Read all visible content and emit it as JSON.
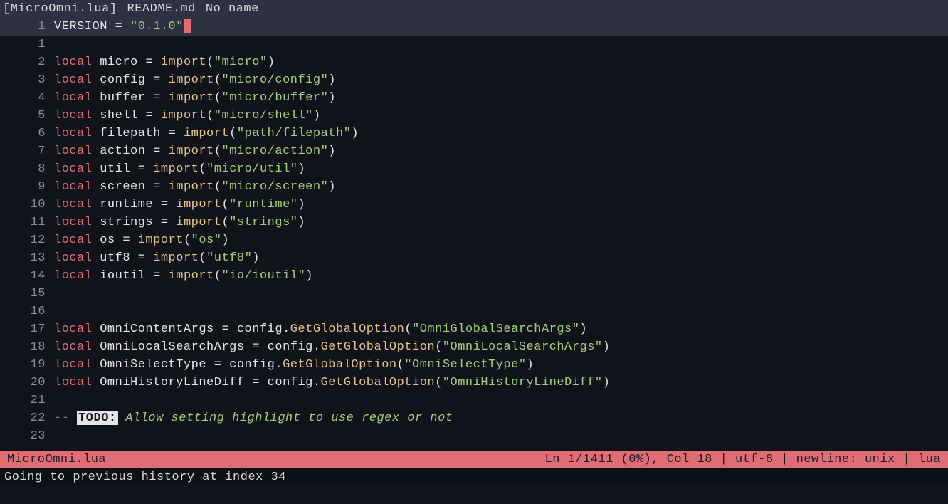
{
  "tabs": [
    {
      "label": "[MicroOmni.lua]",
      "active": true
    },
    {
      "label": "README.md",
      "active": false
    },
    {
      "label": "No name",
      "active": false
    }
  ],
  "code": {
    "lines": [
      {
        "n": 1,
        "current": true,
        "cursor": true,
        "tokens": [
          [
            "ident",
            "VERSION"
          ],
          [
            "op",
            " = "
          ],
          [
            "str",
            "\"0.1.0\""
          ]
        ]
      },
      {
        "n": 1,
        "tokens": []
      },
      {
        "n": 2,
        "tokens": [
          [
            "kw",
            "local"
          ],
          [
            "ident",
            " micro "
          ],
          [
            "op",
            "= "
          ],
          [
            "func",
            "import"
          ],
          [
            "punc",
            "("
          ],
          [
            "str",
            "\"micro\""
          ],
          [
            "punc",
            ")"
          ]
        ]
      },
      {
        "n": 3,
        "tokens": [
          [
            "kw",
            "local"
          ],
          [
            "ident",
            " config "
          ],
          [
            "op",
            "= "
          ],
          [
            "func",
            "import"
          ],
          [
            "punc",
            "("
          ],
          [
            "str",
            "\"micro/config\""
          ],
          [
            "punc",
            ")"
          ]
        ]
      },
      {
        "n": 4,
        "tokens": [
          [
            "kw",
            "local"
          ],
          [
            "ident",
            " buffer "
          ],
          [
            "op",
            "= "
          ],
          [
            "func",
            "import"
          ],
          [
            "punc",
            "("
          ],
          [
            "str",
            "\"micro/buffer\""
          ],
          [
            "punc",
            ")"
          ]
        ]
      },
      {
        "n": 5,
        "tokens": [
          [
            "kw",
            "local"
          ],
          [
            "ident",
            " shell "
          ],
          [
            "op",
            "= "
          ],
          [
            "func",
            "import"
          ],
          [
            "punc",
            "("
          ],
          [
            "str",
            "\"micro/shell\""
          ],
          [
            "punc",
            ")"
          ]
        ]
      },
      {
        "n": 6,
        "tokens": [
          [
            "kw",
            "local"
          ],
          [
            "ident",
            " filepath "
          ],
          [
            "op",
            "= "
          ],
          [
            "func",
            "import"
          ],
          [
            "punc",
            "("
          ],
          [
            "str",
            "\"path/filepath\""
          ],
          [
            "punc",
            ")"
          ]
        ]
      },
      {
        "n": 7,
        "tokens": [
          [
            "kw",
            "local"
          ],
          [
            "ident",
            " action "
          ],
          [
            "op",
            "= "
          ],
          [
            "func",
            "import"
          ],
          [
            "punc",
            "("
          ],
          [
            "str",
            "\"micro/action\""
          ],
          [
            "punc",
            ")"
          ]
        ]
      },
      {
        "n": 8,
        "tokens": [
          [
            "kw",
            "local"
          ],
          [
            "ident",
            " util "
          ],
          [
            "op",
            "= "
          ],
          [
            "func",
            "import"
          ],
          [
            "punc",
            "("
          ],
          [
            "str",
            "\"micro/util\""
          ],
          [
            "punc",
            ")"
          ]
        ]
      },
      {
        "n": 9,
        "tokens": [
          [
            "kw",
            "local"
          ],
          [
            "ident",
            " screen "
          ],
          [
            "op",
            "= "
          ],
          [
            "func",
            "import"
          ],
          [
            "punc",
            "("
          ],
          [
            "str",
            "\"micro/screen\""
          ],
          [
            "punc",
            ")"
          ]
        ]
      },
      {
        "n": 10,
        "tokens": [
          [
            "kw",
            "local"
          ],
          [
            "ident",
            " runtime "
          ],
          [
            "op",
            "= "
          ],
          [
            "func",
            "import"
          ],
          [
            "punc",
            "("
          ],
          [
            "str",
            "\"runtime\""
          ],
          [
            "punc",
            ")"
          ]
        ]
      },
      {
        "n": 11,
        "tokens": [
          [
            "kw",
            "local"
          ],
          [
            "ident",
            " strings "
          ],
          [
            "op",
            "= "
          ],
          [
            "func",
            "import"
          ],
          [
            "punc",
            "("
          ],
          [
            "str",
            "\"strings\""
          ],
          [
            "punc",
            ")"
          ]
        ]
      },
      {
        "n": 12,
        "tokens": [
          [
            "kw",
            "local"
          ],
          [
            "ident",
            " os "
          ],
          [
            "op",
            "= "
          ],
          [
            "func",
            "import"
          ],
          [
            "punc",
            "("
          ],
          [
            "str",
            "\"os\""
          ],
          [
            "punc",
            ")"
          ]
        ]
      },
      {
        "n": 13,
        "tokens": [
          [
            "kw",
            "local"
          ],
          [
            "ident",
            " utf8 "
          ],
          [
            "op",
            "= "
          ],
          [
            "func",
            "import"
          ],
          [
            "punc",
            "("
          ],
          [
            "str",
            "\"utf8\""
          ],
          [
            "punc",
            ")"
          ]
        ]
      },
      {
        "n": 14,
        "diff": true,
        "tokens": [
          [
            "kw",
            "local"
          ],
          [
            "ident",
            " ioutil "
          ],
          [
            "op",
            "= "
          ],
          [
            "func",
            "import"
          ],
          [
            "punc",
            "("
          ],
          [
            "str",
            "\"io/ioutil\""
          ],
          [
            "punc",
            ")"
          ]
        ]
      },
      {
        "n": 15,
        "tokens": []
      },
      {
        "n": 16,
        "tokens": []
      },
      {
        "n": 17,
        "tokens": [
          [
            "kw",
            "local"
          ],
          [
            "ident",
            " OmniContentArgs "
          ],
          [
            "op",
            "= "
          ],
          [
            "ident",
            "config"
          ],
          [
            "punc",
            "."
          ],
          [
            "func",
            "GetGlobalOption"
          ],
          [
            "punc",
            "("
          ],
          [
            "str",
            "\"OmniGlobalSearchArgs\""
          ],
          [
            "punc",
            ")"
          ]
        ]
      },
      {
        "n": 18,
        "tokens": [
          [
            "kw",
            "local"
          ],
          [
            "ident",
            " OmniLocalSearchArgs "
          ],
          [
            "op",
            "= "
          ],
          [
            "ident",
            "config"
          ],
          [
            "punc",
            "."
          ],
          [
            "func",
            "GetGlobalOption"
          ],
          [
            "punc",
            "("
          ],
          [
            "str",
            "\"OmniLocalSearchArgs\""
          ],
          [
            "punc",
            ")"
          ]
        ]
      },
      {
        "n": 19,
        "tokens": [
          [
            "kw",
            "local"
          ],
          [
            "ident",
            " OmniSelectType "
          ],
          [
            "op",
            "= "
          ],
          [
            "ident",
            "config"
          ],
          [
            "punc",
            "."
          ],
          [
            "func",
            "GetGlobalOption"
          ],
          [
            "punc",
            "("
          ],
          [
            "str",
            "\"OmniSelectType\""
          ],
          [
            "punc",
            ")"
          ]
        ]
      },
      {
        "n": 20,
        "tokens": [
          [
            "kw",
            "local"
          ],
          [
            "ident",
            " OmniHistoryLineDiff "
          ],
          [
            "op",
            "= "
          ],
          [
            "ident",
            "config"
          ],
          [
            "punc",
            "."
          ],
          [
            "func",
            "GetGlobalOption"
          ],
          [
            "punc",
            "("
          ],
          [
            "str",
            "\"OmniHistoryLineDiff\""
          ],
          [
            "punc",
            ")"
          ]
        ]
      },
      {
        "n": 21,
        "tokens": []
      },
      {
        "n": 22,
        "tokens": [
          [
            "comment",
            "-- "
          ],
          [
            "todo-hl",
            "TODO:"
          ],
          [
            "todo-txt",
            " Allow setting highlight to use regex or not"
          ]
        ]
      },
      {
        "n": 23,
        "tokens": []
      }
    ]
  },
  "status": {
    "filename": "MicroOmni.lua",
    "position": "Ln 1/1411 (0%), Col 18 | utf-8 | newline: unix | lua"
  },
  "message": "Going to previous history at index 34"
}
